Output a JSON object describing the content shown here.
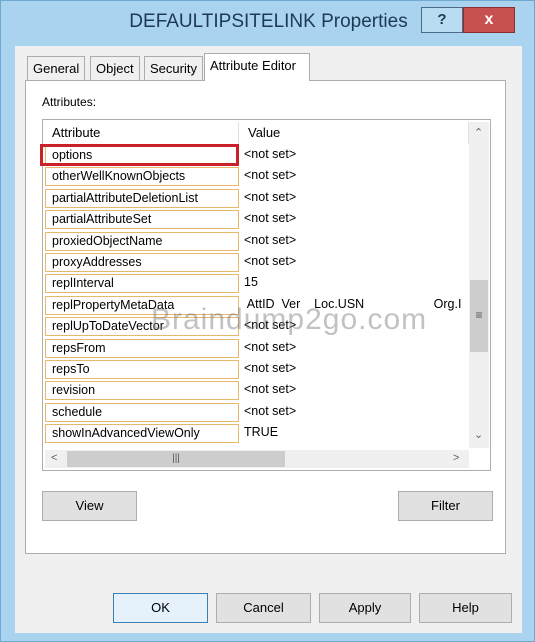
{
  "window": {
    "title": "DEFAULTIPSITELINK Properties",
    "help_label": "?",
    "close_label": "x"
  },
  "tabs": [
    {
      "label": "General"
    },
    {
      "label": "Object"
    },
    {
      "label": "Security"
    },
    {
      "label": "Attribute Editor",
      "active": true
    }
  ],
  "attributes_label": "Attributes:",
  "columns": {
    "attribute": "Attribute",
    "value": "Value"
  },
  "rows": [
    {
      "attribute": "options",
      "value": "<not set>",
      "highlighted": true
    },
    {
      "attribute": "otherWellKnownObjects",
      "value": "<not set>"
    },
    {
      "attribute": "partialAttributeDeletionList",
      "value": "<not set>"
    },
    {
      "attribute": "partialAttributeSet",
      "value": "<not set>"
    },
    {
      "attribute": "proxiedObjectName",
      "value": "<not set>"
    },
    {
      "attribute": "proxyAddresses",
      "value": "<not set>"
    },
    {
      "attribute": "replInterval",
      "value": "15"
    },
    {
      "attribute": "replPropertyMetaData",
      "value": " AttID  Ver    Loc.USN                    Org.I"
    },
    {
      "attribute": "replUpToDateVector",
      "value": "<not set>"
    },
    {
      "attribute": "repsFrom",
      "value": "<not set>"
    },
    {
      "attribute": "repsTo",
      "value": "<not set>"
    },
    {
      "attribute": "revision",
      "value": "<not set>"
    },
    {
      "attribute": "schedule",
      "value": "<not set>"
    },
    {
      "attribute": "showInAdvancedViewOnly",
      "value": "TRUE"
    }
  ],
  "buttons": {
    "view": "View",
    "filter": "Filter",
    "ok": "OK",
    "cancel": "Cancel",
    "apply": "Apply",
    "help": "Help"
  },
  "watermark": "Braindump2go.com",
  "colors": {
    "highlight": "#c9202a",
    "close": "#c75050",
    "frame": "#a9d3ee"
  }
}
